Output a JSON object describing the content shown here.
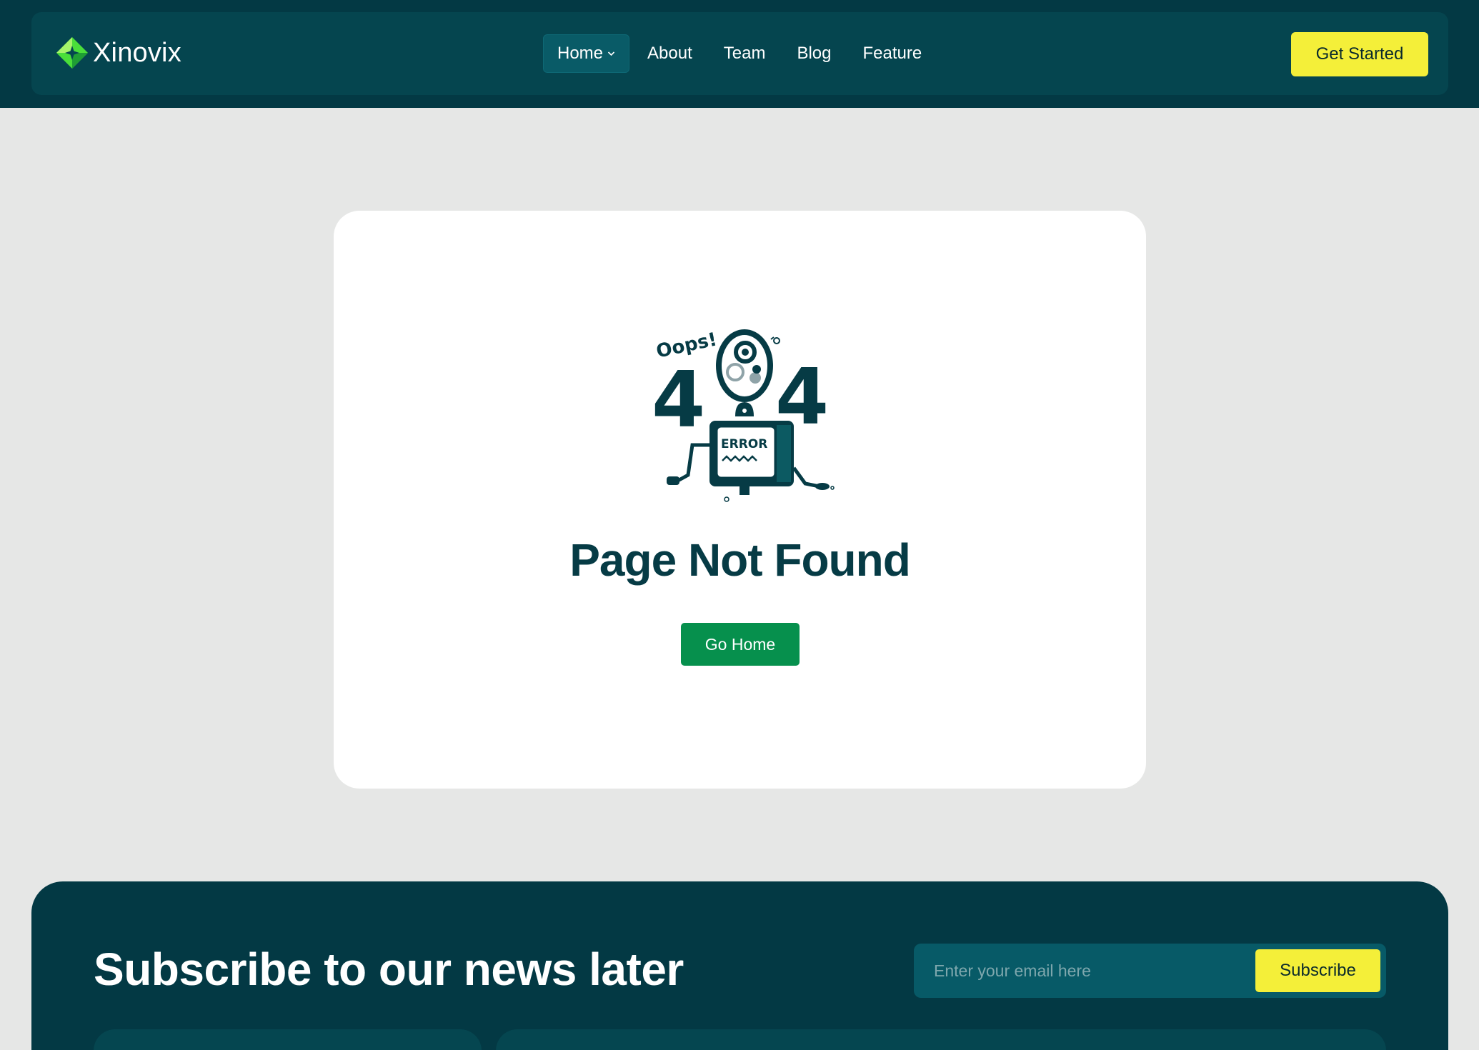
{
  "brand": {
    "name": "Xinovix",
    "logo_icon": "diamond-star-logo",
    "colors": {
      "header": "#033944",
      "accent": "#f4ef39",
      "primary_green": "#06904d",
      "logo_green": "#4ade3a"
    }
  },
  "nav": {
    "items": [
      {
        "label": "Home",
        "active": true,
        "has_dropdown": true
      },
      {
        "label": "About"
      },
      {
        "label": "Team"
      },
      {
        "label": "Blog"
      },
      {
        "label": "Feature"
      }
    ],
    "cta_label": "Get Started"
  },
  "error": {
    "illustration": {
      "oops": "Oops!",
      "digits": [
        "4",
        "4"
      ],
      "screen_text": "ERROR"
    },
    "title": "Page Not Found",
    "button_label": "Go Home"
  },
  "newsletter": {
    "title": "Subscribe to our news later",
    "input_placeholder": "Enter your email here",
    "button_label": "Subscribe"
  }
}
